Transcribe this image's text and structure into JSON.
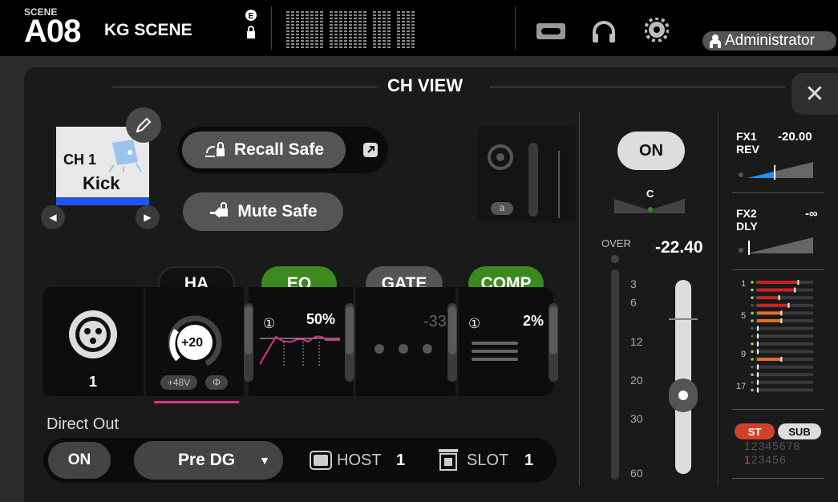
{
  "topbar": {
    "scene_tag": "SCENE",
    "scene_number": "A08",
    "scene_name": "KG SCENE",
    "user": "Administrator"
  },
  "panel": {
    "title": "CH VIEW"
  },
  "channel": {
    "number_label": "CH 1",
    "name": "Kick",
    "color": "#2255ee"
  },
  "buttons": {
    "recall_safe": "Recall Safe",
    "mute_safe": "Mute Safe",
    "on": "ON"
  },
  "input": {
    "port": "1"
  },
  "ha": {
    "label": "HA",
    "gain": "+20",
    "phantom": "+48V",
    "phase": "Φ"
  },
  "eq": {
    "label": "EQ",
    "marker": "①",
    "value": "50%"
  },
  "gate": {
    "label": "GATE",
    "value": "-33"
  },
  "comp": {
    "label": "COMP",
    "marker": "①",
    "value": "2%"
  },
  "direct_out": {
    "label": "Direct Out",
    "on": "ON",
    "point": "Pre DG",
    "host_label": "HOST",
    "host_value": "1",
    "slot_label": "SLOT",
    "slot_value": "1"
  },
  "insert": {
    "badge": "a"
  },
  "pan": {
    "label": "C"
  },
  "fader": {
    "over_label": "OVER",
    "level": "-22.40",
    "scale": [
      "3",
      "6",
      "12",
      "20",
      "30",
      "60"
    ]
  },
  "fx": [
    {
      "name": "FX1",
      "type": "REV",
      "value": "-20.00"
    },
    {
      "name": "FX2",
      "type": "DLY",
      "value": "-∞"
    }
  ],
  "mix_labels": [
    "1",
    "5",
    "9",
    "17"
  ],
  "bus": {
    "st": "ST",
    "sub": "SUB",
    "row1": "12345678",
    "row2_first": "1",
    "row2_rest": "23456"
  }
}
